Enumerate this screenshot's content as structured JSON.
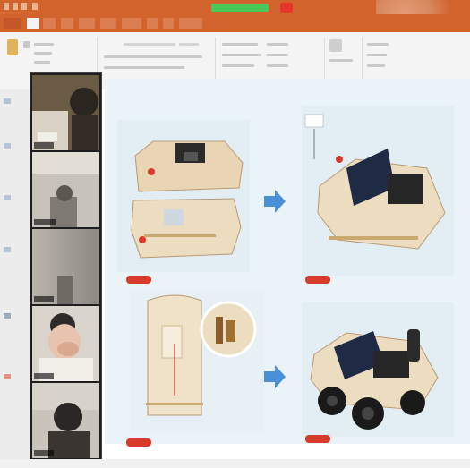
{
  "window": {
    "accent": "#d3632d",
    "meeting_bar_color": "#4bc85a",
    "stop_button_color": "#e8352c"
  },
  "ribbon": {
    "active_tab_color": "#f4f4f4"
  },
  "video_call": {
    "participant_count": 5,
    "tile_label_color": "#ffffff"
  },
  "slide": {
    "background": "#eaf3f8",
    "badge_color": "#d83a2c",
    "arrow_color": "#4a90d9",
    "panels": [
      {
        "name": "top-left-photo",
        "icon": "wooden-car-chassis"
      },
      {
        "name": "top-right-photo",
        "icon": "solar-panel-car-assembly"
      },
      {
        "name": "bottom-left-photo",
        "icon": "chassis-diagram"
      },
      {
        "name": "bottom-right-photo",
        "icon": "finished-car-with-wheels"
      }
    ]
  }
}
